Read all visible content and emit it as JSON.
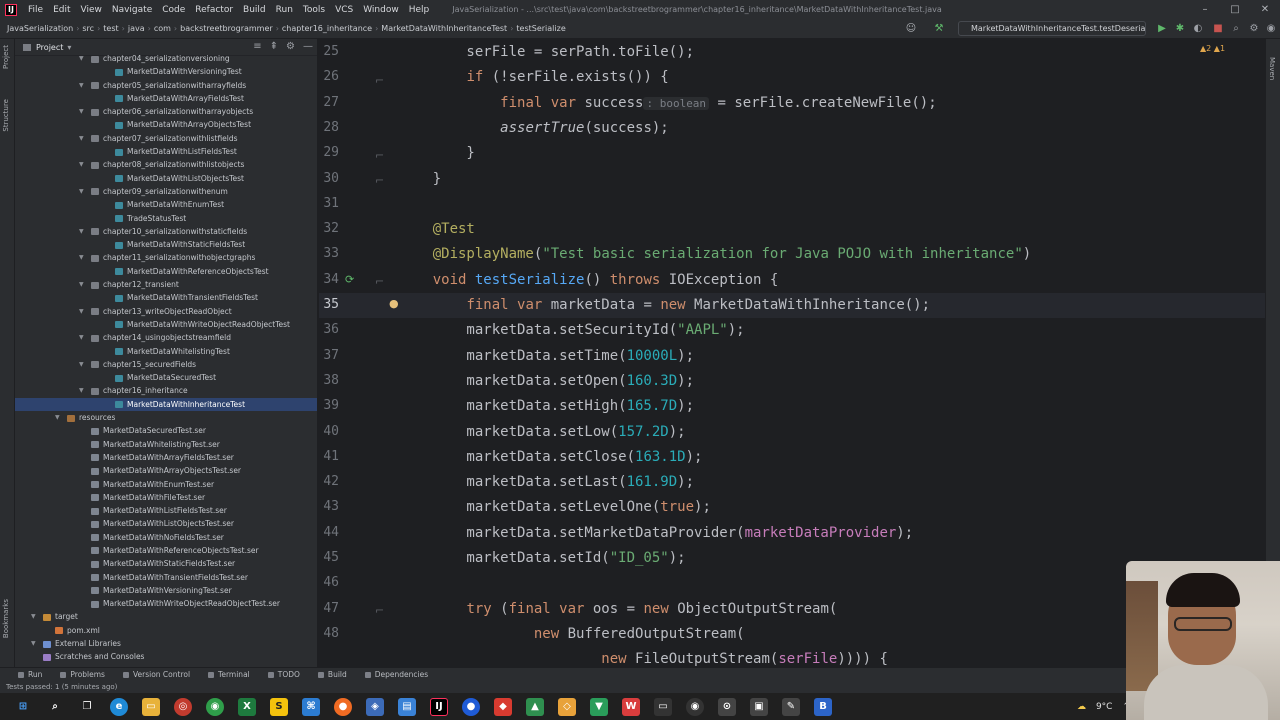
{
  "menubar": {
    "items": [
      "File",
      "Edit",
      "View",
      "Navigate",
      "Code",
      "Refactor",
      "Build",
      "Run",
      "Tools",
      "VCS",
      "Window",
      "Help"
    ],
    "window_path": "JavaSerialization - ...\\src\\test\\java\\com\\backstreetbrogrammer\\chapter16_inheritance\\MarketDataWithInheritanceTest.java"
  },
  "navbar": {
    "crumbs": [
      "JavaSerialization",
      "src",
      "test",
      "java",
      "com",
      "backstreetbrogrammer",
      "chapter16_inheritance",
      "MarketDataWithInheritanceTest",
      "testSerialize"
    ],
    "run_config": "MarketDataWithInheritanceTest.testDeserialize"
  },
  "project": {
    "title": "Project",
    "rows": [
      {
        "label": "chapter04_serializationversioning",
        "indent": 76,
        "type": "folder",
        "arrow": true
      },
      {
        "label": "MarketDataWithVersioningTest",
        "indent": 100,
        "type": "test"
      },
      {
        "label": "chapter05_serializationwitharrayfields",
        "indent": 76,
        "type": "folder",
        "arrow": true
      },
      {
        "label": "MarketDataWithArrayFieldsTest",
        "indent": 100,
        "type": "test"
      },
      {
        "label": "chapter06_serializationwitharrayobjects",
        "indent": 76,
        "type": "folder",
        "arrow": true
      },
      {
        "label": "MarketDataWithArrayObjectsTest",
        "indent": 100,
        "type": "test"
      },
      {
        "label": "chapter07_serializationwithlistfields",
        "indent": 76,
        "type": "folder",
        "arrow": true
      },
      {
        "label": "MarketDataWithListFieldsTest",
        "indent": 100,
        "type": "test"
      },
      {
        "label": "chapter08_serializationwithlistobjects",
        "indent": 76,
        "type": "folder",
        "arrow": true
      },
      {
        "label": "MarketDataWithListObjectsTest",
        "indent": 100,
        "type": "test"
      },
      {
        "label": "chapter09_serializationwithenum",
        "indent": 76,
        "type": "folder",
        "arrow": true
      },
      {
        "label": "MarketDataWithEnumTest",
        "indent": 100,
        "type": "test"
      },
      {
        "label": "TradeStatusTest",
        "indent": 100,
        "type": "test"
      },
      {
        "label": "chapter10_serializationwithstaticfields",
        "indent": 76,
        "type": "folder",
        "arrow": true
      },
      {
        "label": "MarketDataWithStaticFieldsTest",
        "indent": 100,
        "type": "test"
      },
      {
        "label": "chapter11_serializationwithobjectgraphs",
        "indent": 76,
        "type": "folder",
        "arrow": true
      },
      {
        "label": "MarketDataWithReferenceObjectsTest",
        "indent": 100,
        "type": "test"
      },
      {
        "label": "chapter12_transient",
        "indent": 76,
        "type": "folder",
        "arrow": true
      },
      {
        "label": "MarketDataWithTransientFieldsTest",
        "indent": 100,
        "type": "test"
      },
      {
        "label": "chapter13_writeObjectReadObject",
        "indent": 76,
        "type": "folder",
        "arrow": true
      },
      {
        "label": "MarketDataWithWriteObjectReadObjectTest",
        "indent": 100,
        "type": "test"
      },
      {
        "label": "chapter14_usingobjectstreamfield",
        "indent": 76,
        "type": "folder",
        "arrow": true
      },
      {
        "label": "MarketDataWhitelistingTest",
        "indent": 100,
        "type": "test"
      },
      {
        "label": "chapter15_securedFields",
        "indent": 76,
        "type": "folder",
        "arrow": true
      },
      {
        "label": "MarketDataSecuredTest",
        "indent": 100,
        "type": "test"
      },
      {
        "label": "chapter16_inheritance",
        "indent": 76,
        "type": "folder",
        "arrow": true
      },
      {
        "label": "MarketDataWithInheritanceTest",
        "indent": 100,
        "type": "test",
        "selected": true
      },
      {
        "label": "resources",
        "indent": 52,
        "type": "resfolder",
        "arrow": true
      },
      {
        "label": "MarketDataSecuredTest.ser",
        "indent": 76,
        "type": "ser"
      },
      {
        "label": "MarketDataWhitelistingTest.ser",
        "indent": 76,
        "type": "ser"
      },
      {
        "label": "MarketDataWithArrayFieldsTest.ser",
        "indent": 76,
        "type": "ser"
      },
      {
        "label": "MarketDataWithArrayObjectsTest.ser",
        "indent": 76,
        "type": "ser"
      },
      {
        "label": "MarketDataWithEnumTest.ser",
        "indent": 76,
        "type": "ser"
      },
      {
        "label": "MarketDataWithFileTest.ser",
        "indent": 76,
        "type": "ser"
      },
      {
        "label": "MarketDataWithListFieldsTest.ser",
        "indent": 76,
        "type": "ser"
      },
      {
        "label": "MarketDataWithListObjectsTest.ser",
        "indent": 76,
        "type": "ser"
      },
      {
        "label": "MarketDataWithNoFieldsTest.ser",
        "indent": 76,
        "type": "ser"
      },
      {
        "label": "MarketDataWithReferenceObjectsTest.ser",
        "indent": 76,
        "type": "ser"
      },
      {
        "label": "MarketDataWithStaticFieldsTest.ser",
        "indent": 76,
        "type": "ser"
      },
      {
        "label": "MarketDataWithTransientFieldsTest.ser",
        "indent": 76,
        "type": "ser"
      },
      {
        "label": "MarketDataWithVersioningTest.ser",
        "indent": 76,
        "type": "ser"
      },
      {
        "label": "MarketDataWithWriteObjectReadObjectTest.ser",
        "indent": 76,
        "type": "ser"
      },
      {
        "label": "target",
        "indent": 28,
        "type": "target",
        "arrow": true
      },
      {
        "label": "pom.xml",
        "indent": 40,
        "type": "xml"
      },
      {
        "label": "External Libraries",
        "indent": 28,
        "type": "lib",
        "arrow": true
      },
      {
        "label": "Scratches and Consoles",
        "indent": 28,
        "type": "scratch",
        "arrow": false
      }
    ]
  },
  "editor": {
    "current_line": "35",
    "lines": [
      {
        "n": "25",
        "tokens": [
          {
            "t": "        serFile = serPath.toFile();",
            "c": ""
          }
        ]
      },
      {
        "n": "26",
        "tokens": [
          {
            "t": "        ",
            "c": ""
          },
          {
            "t": "if",
            "c": "kw"
          },
          {
            "t": " (!serFile.exists()) {",
            "c": ""
          }
        ]
      },
      {
        "n": "27",
        "tokens": [
          {
            "t": "            ",
            "c": ""
          },
          {
            "t": "final var",
            "c": "kw"
          },
          {
            "t": " success",
            "c": ""
          },
          {
            "t": ": boolean",
            "c": "hint"
          },
          {
            "t": " = serFile.createNewFile();",
            "c": ""
          }
        ]
      },
      {
        "n": "28",
        "tokens": [
          {
            "t": "            ",
            "c": ""
          },
          {
            "t": "assertTrue",
            "c": "it"
          },
          {
            "t": "(success);",
            "c": ""
          }
        ]
      },
      {
        "n": "29",
        "tokens": [
          {
            "t": "        }",
            "c": ""
          }
        ]
      },
      {
        "n": "30",
        "tokens": [
          {
            "t": "    }",
            "c": ""
          }
        ]
      },
      {
        "n": "31",
        "tokens": [
          {
            "t": "",
            "c": ""
          }
        ]
      },
      {
        "n": "32",
        "tokens": [
          {
            "t": "    ",
            "c": ""
          },
          {
            "t": "@Test",
            "c": "an"
          }
        ]
      },
      {
        "n": "33",
        "tokens": [
          {
            "t": "    ",
            "c": ""
          },
          {
            "t": "@DisplayName",
            "c": "an"
          },
          {
            "t": "(",
            "c": ""
          },
          {
            "t": "\"Test basic serialization for Java POJO with inheritance\"",
            "c": "str"
          },
          {
            "t": ")",
            "c": ""
          }
        ]
      },
      {
        "n": "34",
        "tokens": [
          {
            "t": "    ",
            "c": ""
          },
          {
            "t": "void",
            "c": "kw"
          },
          {
            "t": " ",
            "c": ""
          },
          {
            "t": "testSerialize",
            "c": "fn"
          },
          {
            "t": "() ",
            "c": ""
          },
          {
            "t": "throws",
            "c": "kw"
          },
          {
            "t": " IOException {",
            "c": ""
          }
        ]
      },
      {
        "n": "35",
        "tokens": [
          {
            "t": "        ",
            "c": ""
          },
          {
            "t": "final var",
            "c": "kw"
          },
          {
            "t": " marketData = ",
            "c": ""
          },
          {
            "t": "new",
            "c": "kw"
          },
          {
            "t": " MarketDataWithInheritance();",
            "c": ""
          }
        ]
      },
      {
        "n": "36",
        "tokens": [
          {
            "t": "        marketData.setSecurityId(",
            "c": ""
          },
          {
            "t": "\"AAPL\"",
            "c": "str"
          },
          {
            "t": ");",
            "c": ""
          }
        ]
      },
      {
        "n": "37",
        "tokens": [
          {
            "t": "        marketData.setTime(",
            "c": ""
          },
          {
            "t": "10000L",
            "c": "num"
          },
          {
            "t": ");",
            "c": ""
          }
        ]
      },
      {
        "n": "38",
        "tokens": [
          {
            "t": "        marketData.setOpen(",
            "c": ""
          },
          {
            "t": "160.3D",
            "c": "num"
          },
          {
            "t": ");",
            "c": ""
          }
        ]
      },
      {
        "n": "39",
        "tokens": [
          {
            "t": "        marketData.setHigh(",
            "c": ""
          },
          {
            "t": "165.7D",
            "c": "num"
          },
          {
            "t": ");",
            "c": ""
          }
        ]
      },
      {
        "n": "40",
        "tokens": [
          {
            "t": "        marketData.setLow(",
            "c": ""
          },
          {
            "t": "157.2D",
            "c": "num"
          },
          {
            "t": ");",
            "c": ""
          }
        ]
      },
      {
        "n": "41",
        "tokens": [
          {
            "t": "        marketData.setClose(",
            "c": ""
          },
          {
            "t": "163.1D",
            "c": "num"
          },
          {
            "t": ");",
            "c": ""
          }
        ]
      },
      {
        "n": "42",
        "tokens": [
          {
            "t": "        marketData.setLast(",
            "c": ""
          },
          {
            "t": "161.9D",
            "c": "num"
          },
          {
            "t": ");",
            "c": ""
          }
        ]
      },
      {
        "n": "43",
        "tokens": [
          {
            "t": "        marketData.setLevelOne(",
            "c": ""
          },
          {
            "t": "true",
            "c": "kw"
          },
          {
            "t": ");",
            "c": ""
          }
        ]
      },
      {
        "n": "44",
        "tokens": [
          {
            "t": "        marketData.setMarketDataProvider(",
            "c": ""
          },
          {
            "t": "marketDataProvider",
            "c": "fld"
          },
          {
            "t": ");",
            "c": ""
          }
        ]
      },
      {
        "n": "45",
        "tokens": [
          {
            "t": "        marketData.setId(",
            "c": ""
          },
          {
            "t": "\"ID_05\"",
            "c": "str"
          },
          {
            "t": ");",
            "c": ""
          }
        ]
      },
      {
        "n": "46",
        "tokens": [
          {
            "t": "",
            "c": ""
          }
        ]
      },
      {
        "n": "47",
        "tokens": [
          {
            "t": "        ",
            "c": ""
          },
          {
            "t": "try",
            "c": "kw"
          },
          {
            "t": " (",
            "c": ""
          },
          {
            "t": "final var",
            "c": "kw"
          },
          {
            "t": " oos = ",
            "c": ""
          },
          {
            "t": "new",
            "c": "kw"
          },
          {
            "t": " ObjectOutputStream(",
            "c": ""
          }
        ]
      },
      {
        "n": "48",
        "tokens": [
          {
            "t": "                ",
            "c": ""
          },
          {
            "t": "new",
            "c": "kw"
          },
          {
            "t": " BufferedOutputStream(",
            "c": ""
          }
        ]
      },
      {
        "n": "",
        "tokens": [
          {
            "t": "                        ",
            "c": ""
          },
          {
            "t": "new",
            "c": "kw"
          },
          {
            "t": " FileOutputStream(",
            "c": ""
          },
          {
            "t": "serFile",
            "c": "fld"
          },
          {
            "t": ")))) {",
            "c": ""
          }
        ]
      }
    ]
  },
  "warnings": "▲2 ▲1",
  "bottom_tabs": [
    "Run",
    "Problems",
    "Version Control",
    "Terminal",
    "TODO",
    "Build",
    "Dependencies"
  ],
  "status": "Tests passed: 1 (5 minutes ago)",
  "tray": {
    "temperature": "9°C"
  },
  "colors": {
    "selection": "#2e436e",
    "keyword": "#cf8e6d",
    "string": "#6aab73",
    "number": "#2aacb8",
    "annotation": "#b3ae60",
    "method": "#56a8f5"
  }
}
